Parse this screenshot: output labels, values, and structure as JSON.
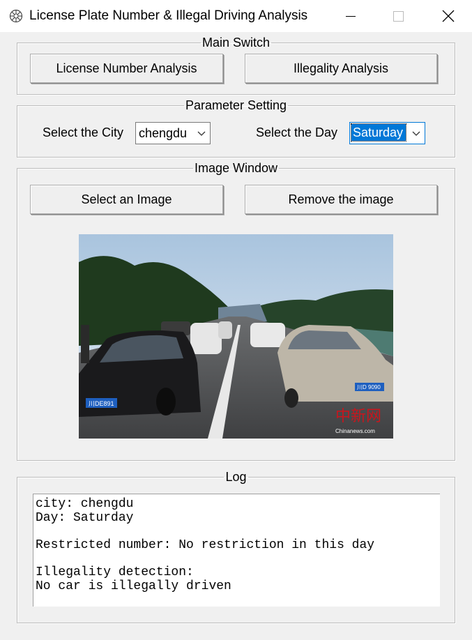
{
  "window": {
    "title": "License Plate Number & Illegal Driving Analysis"
  },
  "main_switch": {
    "title": "Main Switch",
    "license_button": "License Number Analysis",
    "illegality_button": "Illegality Analysis"
  },
  "parameter_setting": {
    "title": "Parameter Setting",
    "city_label": "Select the City",
    "city_value": "chengdu",
    "day_label": "Select the Day",
    "day_value": "Saturday"
  },
  "image_window": {
    "title": "Image Window",
    "select_button": "Select an Image",
    "remove_button": "Remove the image",
    "photo": {
      "description": "traffic-jam-highway-photo",
      "plate_left": "川DE891",
      "plate_right": "川D 9090",
      "watermark_cn": "中新网",
      "watermark_en": "Chinanews.com"
    }
  },
  "log": {
    "title": "Log",
    "lines": [
      "city: chengdu",
      "Day: Saturday",
      "",
      "Restricted number: No restriction in this day",
      "",
      "Illegality detection:",
      "No car is illegally driven"
    ]
  },
  "colors": {
    "window_bg": "#f0f0f0",
    "accent_focus": "#0078d7"
  }
}
